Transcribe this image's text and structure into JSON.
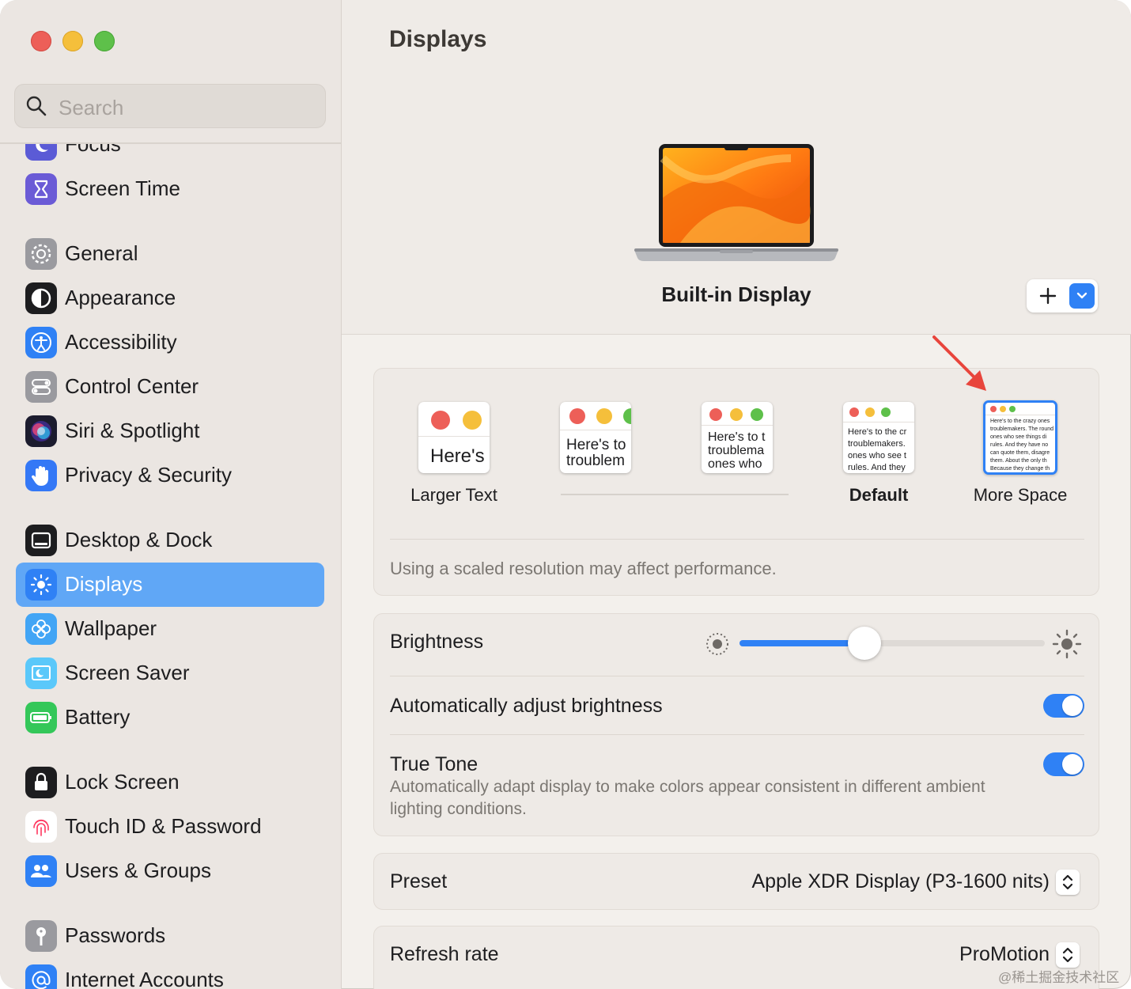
{
  "window": {
    "title": "Displays"
  },
  "sidebar": {
    "search_placeholder": "Search",
    "items": [
      {
        "label": "Focus",
        "icon": "moon-icon",
        "color": "#5b5bd6"
      },
      {
        "label": "Screen Time",
        "icon": "hourglass-icon",
        "color": "#6b5bd6"
      },
      {
        "label": "General",
        "icon": "gear-icon",
        "color": "#8e8e93"
      },
      {
        "label": "Appearance",
        "icon": "appearance-icon",
        "color": "#1d1d1f"
      },
      {
        "label": "Accessibility",
        "icon": "accessibility-icon",
        "color": "#2f81f5"
      },
      {
        "label": "Control Center",
        "icon": "control-center-icon",
        "color": "#8e8e93"
      },
      {
        "label": "Siri & Spotlight",
        "icon": "siri-icon",
        "color": "#7a3fd1"
      },
      {
        "label": "Privacy & Security",
        "icon": "hand-icon",
        "color": "#3478f6"
      },
      {
        "label": "Desktop & Dock",
        "icon": "dock-icon",
        "color": "#1d1d1f"
      },
      {
        "label": "Displays",
        "icon": "sun-icon",
        "color": "#2f81f5",
        "selected": true
      },
      {
        "label": "Wallpaper",
        "icon": "flower-icon",
        "color": "#42a5f5"
      },
      {
        "label": "Screen Saver",
        "icon": "screen-saver-icon",
        "color": "#5ac8fa"
      },
      {
        "label": "Battery",
        "icon": "battery-icon",
        "color": "#34c759"
      },
      {
        "label": "Lock Screen",
        "icon": "lock-icon",
        "color": "#1d1d1f"
      },
      {
        "label": "Touch ID & Password",
        "icon": "fingerprint-icon",
        "color": "#ff375f"
      },
      {
        "label": "Users & Groups",
        "icon": "users-icon",
        "color": "#2f81f5"
      },
      {
        "label": "Passwords",
        "icon": "key-icon",
        "color": "#8e8e93"
      },
      {
        "label": "Internet Accounts",
        "icon": "at-icon",
        "color": "#2f81f5"
      }
    ]
  },
  "main": {
    "title": "Displays",
    "display_name": "Built-in Display",
    "add_button_icon": "plus-icon",
    "dropdown_icon": "chevron-down-icon",
    "resolution": {
      "options": [
        {
          "label": "Larger Text",
          "preview": "Here's",
          "selected": false,
          "bold": false
        },
        {
          "label": "",
          "preview": "Here's to troublem",
          "selected": false,
          "bold": false
        },
        {
          "label": "",
          "preview": "Here's to t troublema ones who",
          "selected": false,
          "bold": false
        },
        {
          "label": "Default",
          "preview": "Here's to the cr troublemakers. ones who see t rules. And they",
          "selected": false,
          "bold": true
        },
        {
          "label": "More Space",
          "preview": "Here's to the crazy ones troublemakers. The round ones who see things di rules. And they have no can quote them, disagre them. About the only th Because they change th",
          "selected": true,
          "bold": false
        }
      ],
      "note": "Using a scaled resolution may affect performance."
    },
    "brightness": {
      "label": "Brightness",
      "value": 0.41
    },
    "auto_brightness": {
      "label": "Automatically adjust brightness",
      "on": true
    },
    "true_tone": {
      "label": "True Tone",
      "description": "Automatically adapt display to make colors appear consistent in different ambient lighting conditions.",
      "on": true
    },
    "preset": {
      "label": "Preset",
      "value": "Apple XDR Display (P3-1600 nits)"
    },
    "refresh_rate": {
      "label": "Refresh rate",
      "value": "ProMotion"
    }
  },
  "watermark": "@稀土掘金技术社区",
  "colors": {
    "accent": "#2f81f5",
    "selection": "#60a7f6",
    "annotation_arrow": "#e8453c"
  }
}
